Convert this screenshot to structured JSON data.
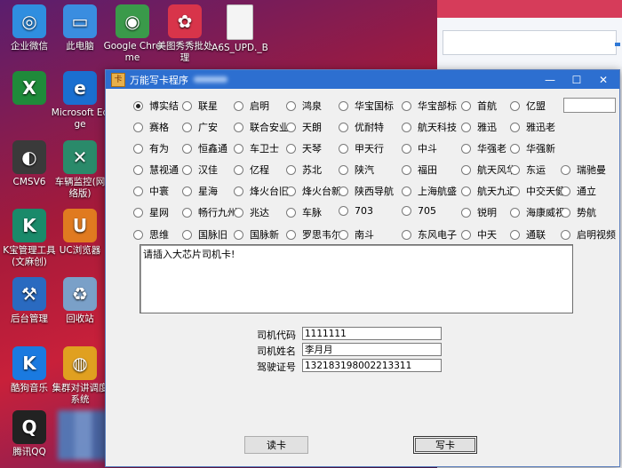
{
  "desktop": {
    "icons": [
      {
        "label": "企业微信",
        "color": "#2f8ee0",
        "glyph": "◎",
        "icon": "wecom-icon"
      },
      {
        "label": "此电脑",
        "color": "#3a8de0",
        "glyph": "▭",
        "icon": "computer-icon"
      },
      {
        "label": "Google Chrome",
        "color": "#3a9a4a",
        "glyph": "◉",
        "icon": "chrome-icon"
      },
      {
        "label": "美图秀秀批处理",
        "color": "#d8344a",
        "glyph": "✿",
        "icon": "meitu-icon"
      },
      {
        "label": "A6S_UPD._B",
        "color": "#f4f4f4",
        "glyph": "",
        "icon": "file-icon"
      },
      {
        "label": "",
        "color": "#1f8a3a",
        "glyph": "X",
        "icon": "excel-icon"
      },
      {
        "label": "Microsoft Edge",
        "color": "#1a6fd0",
        "glyph": "e",
        "icon": "edge-icon"
      },
      {
        "label": "CMSV6",
        "color": "#3a3a3a",
        "glyph": "◐",
        "icon": "cmsv6-icon"
      },
      {
        "label": "车辆监控(网络版)",
        "color": "#2a8a6a",
        "glyph": "✕",
        "icon": "vehicle-monitor-icon"
      },
      {
        "label": "K宝管理工具(文麻创)",
        "color": "#1a8a6a",
        "glyph": "K",
        "icon": "kbao-icon"
      },
      {
        "label": "UC浏览器",
        "color": "#e07a20",
        "glyph": "U",
        "icon": "uc-browser-icon"
      },
      {
        "label": "后台管理",
        "color": "#2a6ac0",
        "glyph": "⚒",
        "icon": "admin-icon"
      },
      {
        "label": "回收站",
        "color": "#7aa0c8",
        "glyph": "♻",
        "icon": "recycle-bin-icon"
      },
      {
        "label": "酷狗音乐",
        "color": "#1a7ae0",
        "glyph": "K",
        "icon": "kugou-icon"
      },
      {
        "label": "集群对讲调度系统",
        "color": "#e0a020",
        "glyph": "◍",
        "icon": "intercom-icon"
      },
      {
        "label": "腾讯QQ",
        "color": "#222222",
        "glyph": "Q",
        "icon": "qq-icon"
      }
    ]
  },
  "window": {
    "title": "万能写卡程序",
    "app_glyph": "卡"
  },
  "radio_groups": {
    "options": [
      "博实结",
      "联星",
      "启明",
      "鸿泉",
      "华宝国标",
      "华宝部标",
      "首航",
      "亿盟",
      "赛格",
      "广安",
      "联合安业",
      "天朗",
      "优耐特",
      "航天科技",
      "雅迅",
      "雅迅老",
      "有为",
      "恒鑫通",
      "车卫士",
      "天琴",
      "甲天行",
      "中斗",
      "华强老",
      "华强新",
      "慧视通",
      "汉佳",
      "亿程",
      "苏北",
      "陕汽",
      "福田",
      "航天风华",
      "东运",
      "瑞驰曼",
      "中寰",
      "星海",
      "烽火台旧",
      "烽火台新",
      "陕西导航",
      "上海航盛",
      "航天九通",
      "中交天健",
      "通立",
      "星网",
      "畅行九州",
      "兆达",
      "车脉",
      "703",
      "705",
      "锐明",
      "海康威视",
      "势航",
      "思维",
      "国脉旧",
      "国脉新",
      "罗思韦尔",
      "南斗",
      "东风电子",
      "中天",
      "通联",
      "启明视频"
    ],
    "selected": "博实结"
  },
  "top_input": {
    "value": ""
  },
  "message": {
    "text": "请插入大芯片司机卡!"
  },
  "fields": {
    "driver_code_label": "司机代码",
    "driver_code": "1111111",
    "driver_name_label": "司机姓名",
    "driver_name": "李月月",
    "license_label": "驾驶证号",
    "license_no": "132183198002213311"
  },
  "buttons": {
    "read": "读卡",
    "write": "写卡"
  }
}
